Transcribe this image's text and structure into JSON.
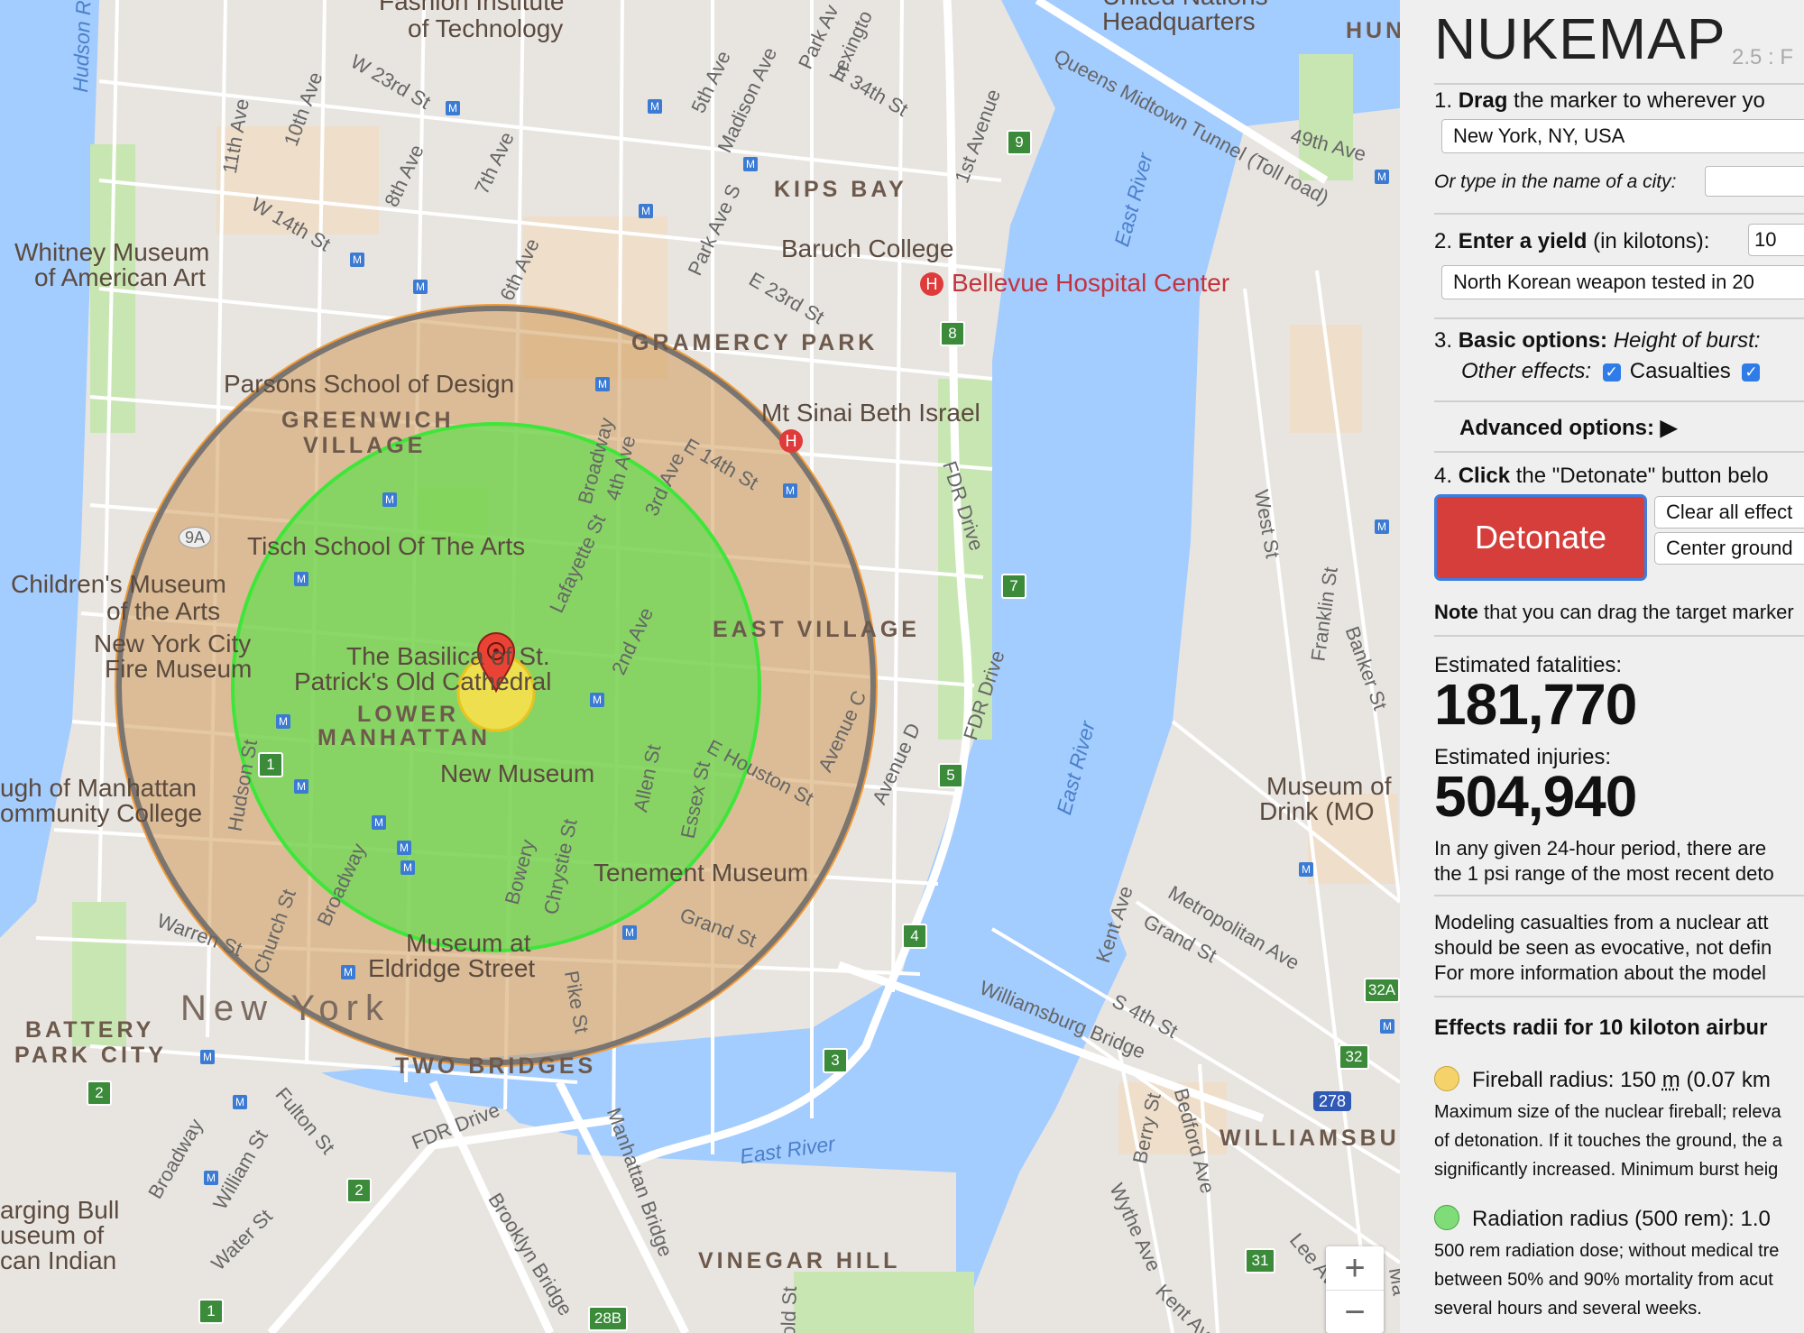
{
  "map": {
    "labels": {
      "fit": "Fashion Institute",
      "fit2": "of Technology",
      "un": "United Nations",
      "un2": "Headquarters",
      "hun": "HUN",
      "whitney": "Whitney Museum",
      "whitney2": "of American Art",
      "kips": "KIPS BAY",
      "baruch": "Baruch College",
      "bellevue": "Bellevue Hospital Center",
      "gramercy": "GRAMERCY PARK",
      "parsons": "Parsons School of Design",
      "greenwich": "GREENWICH",
      "village": "VILLAGE",
      "sinai": "Mt Sinai Beth Israel",
      "tisch": "Tisch School Of The Arts",
      "children": "Children's Museum",
      "children2": "of the Arts",
      "nyfire": "New York City",
      "nyfire2": "Fire Museum",
      "basilica": "The Basilica of St.",
      "basilica2": "Patrick's Old Cathedral",
      "lower": "LOWER",
      "manhattan": "MANHATTAN",
      "eastvillage": "EAST VILLAGE",
      "newmuseum": "New Museum",
      "bmcc": "ugh of Manhattan",
      "bmcc2": "ommunity College",
      "tenement": "Tenement Museum",
      "eldridge": "Museum at",
      "eldridge2": "Eldridge Street",
      "newyork": "New York",
      "battery": "BATTERY",
      "battery2": "PARK CITY",
      "twobridges": "TWO BRIDGES",
      "chargingbull": "arging Bull",
      "museumof": "useum of",
      "indian": "can Indian",
      "vinegar": "VINEGAR HILL",
      "williamsburg": "WILLIAMSBUR",
      "drink": "Museum of",
      "drink2": "Drink (MO",
      "eastriver1": "East River",
      "eastriver2": "East River",
      "eastriver3": "East River",
      "hudson": "Hudson R",
      "s11": "11th Ave",
      "s10": "10th Ave",
      "w23": "W 23rd St",
      "s8": "8th Ave",
      "s7": "7th Ave",
      "s6": "6th Ave",
      "w14": "W 14th St",
      "s5": "5th Ave",
      "madison": "Madison Ave",
      "parkav": "Park Av",
      "lex": "Lexingto",
      "e34": "E 34th St",
      "s1": "1st Avenue",
      "qmt": "Queens Midtown Tunnel (Toll road)",
      "e49": "49th Ave",
      "parkaves": "Park Ave S",
      "e23": "E 23rd St",
      "broadway": "Broadway",
      "s4": "4th Ave",
      "s3": "3rd Ave",
      "e14": "E 14th St",
      "fdr": "FDR Drive",
      "lafayette": "Lafayette St",
      "s2": "2nd Ave",
      "avec": "Avenue C",
      "aved": "Avenue D",
      "fdr2": "FDR Drive",
      "ehouston": "E Houston St",
      "allen": "Allen St",
      "essex": "Essex St",
      "bowery": "Bowery",
      "chrystie": "Chrystie St",
      "hudsonst": "Hudson St",
      "broadway2": "Broadway",
      "church": "Church St",
      "warren": "Warren St",
      "grand": "Grand St",
      "pike": "Pike St",
      "fdr3": "FDR Drive",
      "manhattanbr": "Manhattan Bridge",
      "brooklynbr": "Brooklyn Bridge",
      "williamsburgbr": "Williamsburg Bridge",
      "fulton": "Fulton St",
      "broadway3": "Broadway",
      "william": "William St",
      "water": "Water St",
      "westst": "West St",
      "franklin": "Franklin St",
      "banker": "Banker St",
      "kent": "Kent Ave",
      "grand2": "Grand St",
      "metro": "Metropolitan Ave",
      "s4th": "S 4th St",
      "berry": "Berry St",
      "bedford": "Bedford Ave",
      "wythe": "Wythe Ave",
      "kent2": "Kent Ave",
      "lee": "Lee Ave",
      "gold": "Gold St",
      "ma": "Ma",
      "i278": "278",
      "s9a": "9A"
    },
    "shields": [
      "9",
      "8",
      "7",
      "5",
      "4",
      "3",
      "2",
      "2",
      "1",
      "1",
      "28B",
      "31",
      "32",
      "32A"
    ],
    "zoom_in": "+",
    "zoom_out": "−",
    "colors": {
      "water": "#a3ccff",
      "park": "#c8e6b2",
      "fireball": "#ffe14a",
      "radiation": "#62e04f",
      "blast": "#d2a15e",
      "marker": "#ea4335"
    }
  },
  "panel": {
    "title": "NUKEMAP",
    "version": "2.5 : F",
    "step1_num": "1.",
    "step1_bold": "Drag",
    "step1_rest": "the marker to wherever yo",
    "location": "New York, NY, USA",
    "city_prompt": "Or type in the name of a city:",
    "step2_num": "2.",
    "step2_bold": "Enter a yield",
    "step2_rest": "(in kilotons):",
    "yield": "10",
    "preset": "North Korean weapon tested in 20",
    "step3_num": "3.",
    "step3_bold": "Basic options:",
    "step3_italic": "Height of burst:",
    "other_effects": "Other effects:",
    "casualties": "Casualties",
    "advanced": "Advanced options:",
    "advanced_arrow": "▶",
    "step4_num": "4.",
    "step4_bold": "Click",
    "step4_rest": "the \"Detonate\" button belo",
    "detonate": "Detonate",
    "clear": "Clear all effect",
    "center": "Center ground",
    "note_bold": "Note",
    "note_rest": "that you can drag the target marker",
    "fatal_label": "Estimated fatalities:",
    "fatalities": "181,770",
    "injury_label": "Estimated injuries:",
    "injuries": "504,940",
    "period1": "In any given 24-hour period, there are",
    "period2": "the 1 psi range of the most recent deto",
    "model1": "Modeling casualties from a nuclear att",
    "model2": "should be seen as evocative, not defin",
    "model3": "For more information about the model",
    "effects_title": "Effects radii for 10 kiloton airbur",
    "fireball_label": "Fireball radius: 150",
    "fireball_unit": "m",
    "fireball_km": "(0.07 km",
    "fireball_d1": "Maximum size of the nuclear fireball; releva",
    "fireball_d2": "of detonation. If it touches the ground, the a",
    "fireball_d3": "significantly increased. Minimum burst heig",
    "radiation_label": "Radiation radius (500 rem): 1.0",
    "radiation_d1": "500 rem radiation dose; without medical tre",
    "radiation_d2": "between 50% and 90% mortality from acut",
    "radiation_d3": "several hours and several weeks."
  }
}
